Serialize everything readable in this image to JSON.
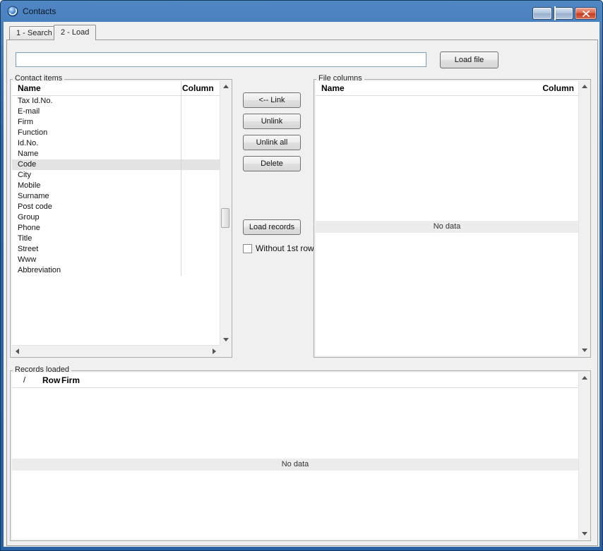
{
  "window": {
    "title": "Contacts",
    "controls": [
      "minimize",
      "maximize",
      "close"
    ]
  },
  "tabs": [
    {
      "label": "1 - Search",
      "active": false
    },
    {
      "label": "2 - Load",
      "active": true
    }
  ],
  "toolbar": {
    "file_path_value": "",
    "load_file_button": "Load file"
  },
  "contact_items": {
    "group_label": "Contact items",
    "columns": [
      "Name",
      "Column"
    ],
    "rows": [
      "Tax Id.No.",
      "E-mail",
      "Firm",
      "Function",
      "Id.No.",
      "Name",
      "Code",
      "City",
      "Mobile",
      "Surname",
      "Post code",
      "Group",
      "Phone",
      "Title",
      "Street",
      "Www",
      "Abbreviation"
    ],
    "selected_row": "Code"
  },
  "actions": {
    "link_button": "<-- Link",
    "unlink_button": "Unlink",
    "unlink_all_button": "Unlink all",
    "delete_button": "Delete",
    "load_records_button": "Load records",
    "without_first_row_label": "Without 1st row",
    "without_first_row_checked": false
  },
  "file_columns": {
    "group_label": "File columns",
    "columns": [
      "Name",
      "Column"
    ],
    "empty_text": "No data"
  },
  "records_loaded": {
    "group_label": "Records loaded",
    "columns": [
      "/",
      "Row",
      "Firm"
    ],
    "empty_text": "No data"
  },
  "colors": {
    "titlebar_blue": "#2e66aa",
    "selection_gray": "#e3e3e3",
    "nodata_band": "#ececec",
    "close_button_red": "#c23b22"
  }
}
